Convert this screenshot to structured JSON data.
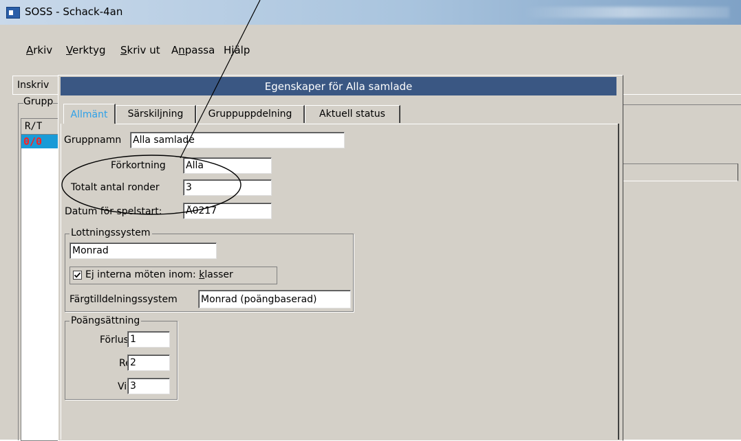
{
  "window": {
    "title": "SOSS - Schack-4an"
  },
  "menu": [
    {
      "label": "Arkiv",
      "mnemonic_index": 0
    },
    {
      "label": "Verktyg",
      "mnemonic_index": 0
    },
    {
      "label": "Skriv ut",
      "mnemonic_index": 0
    },
    {
      "label": "Anpassa",
      "mnemonic_index": 1
    },
    {
      "label": "Hjälp",
      "mnemonic_index": 1
    }
  ],
  "background": {
    "tab_label": "Inskriv",
    "group_label": "Grupp",
    "list_header": "R/T",
    "list_row": "0/0"
  },
  "dialog": {
    "title": "Egenskaper för Alla samlade",
    "tabs": [
      "Allmänt",
      "Särskiljning",
      "Gruppuppdelning",
      "Aktuell status"
    ],
    "fields": {
      "gruppnamn_label": "Gruppnamn",
      "gruppnamn_value": "Alla samlade",
      "forkortning_label": "Förkortning",
      "forkortning_value": "Alla",
      "ronder_label": "Totalt antal ronder",
      "ronder_value": "3",
      "datum_label": "Datum för spelstart:",
      "datum_value": "Å0217"
    },
    "lottning": {
      "legend": "Lottningssystem",
      "system_value": "Monrad",
      "checkbox_label": "Ej interna möten inom: klasser",
      "checkbox_checked": true,
      "fargtilldelning_label": "Färgtilldelningssystem",
      "fargtilldelning_value": "Monrad (poängbaserad)"
    },
    "poang": {
      "legend": "Poängsättning",
      "forlust_label": "Förlust",
      "forlust_value": "1",
      "remi_label": "Remi",
      "remi_value": "2",
      "vinst_label": "Vinst",
      "vinst_value": "3"
    }
  },
  "colors": {
    "dialog_title_bg": "#3a5783",
    "active_tab_text": "#2da0e8",
    "selected_row_bg": "#1a9bd7",
    "selected_row_text": "#ff2020"
  }
}
